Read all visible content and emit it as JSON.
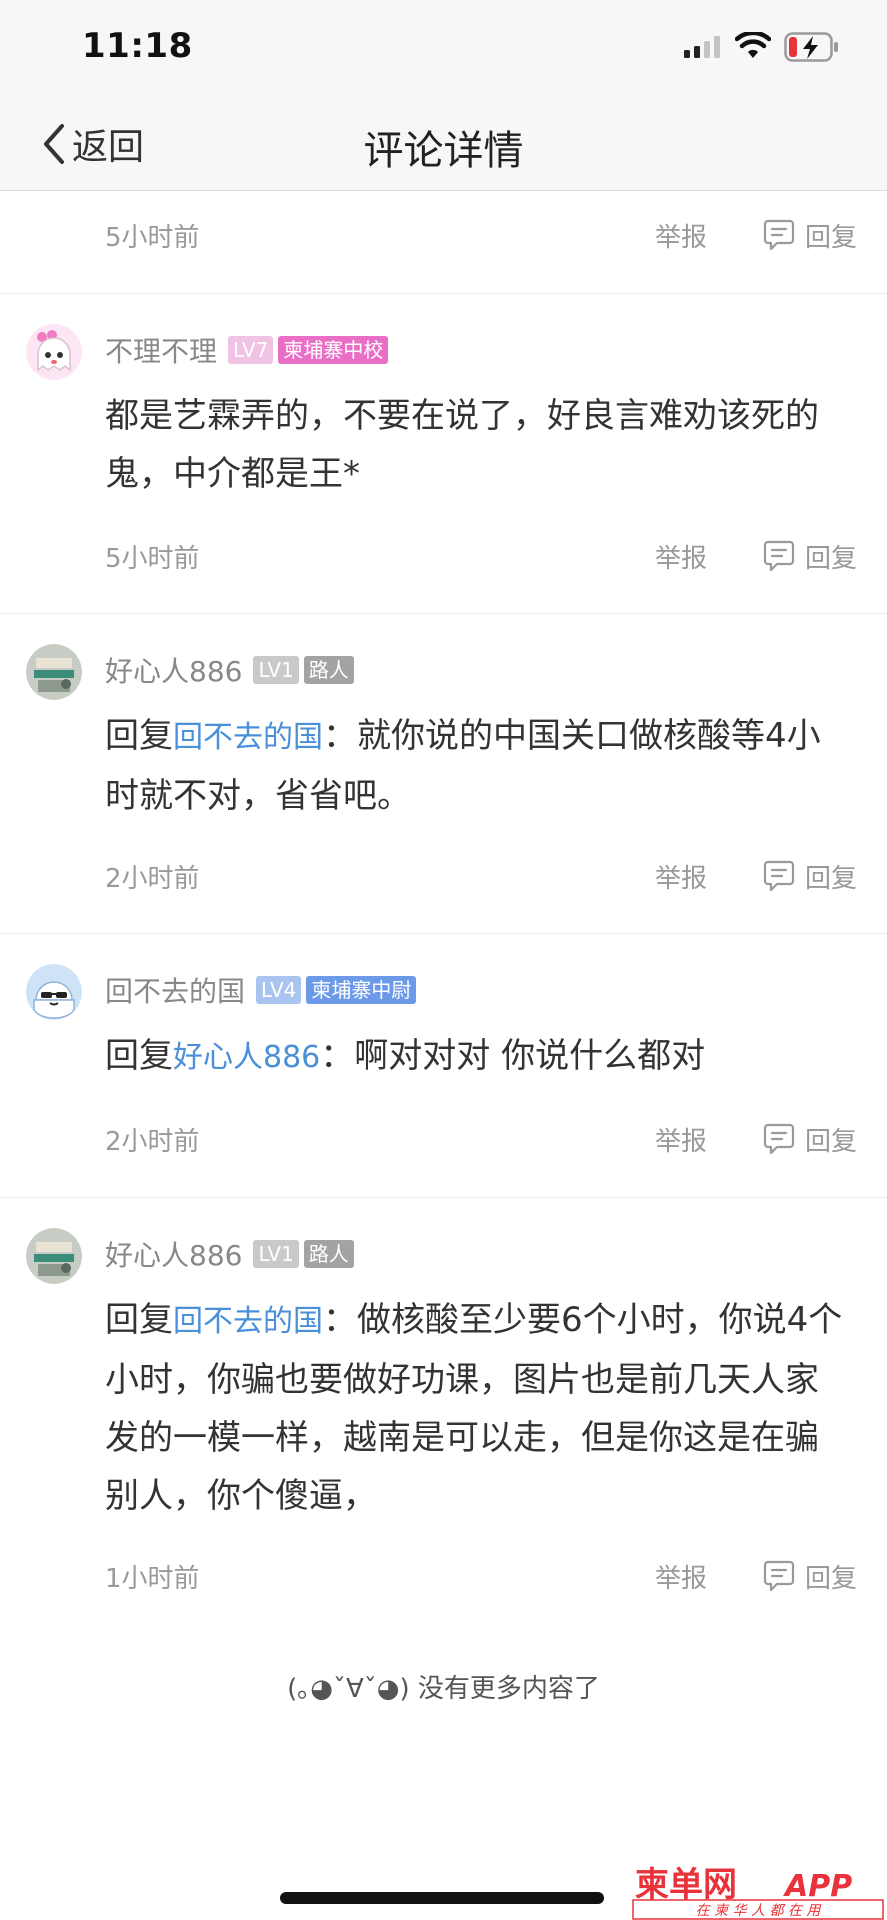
{
  "status_bar": {
    "time": "11:18",
    "icons": [
      "cellular-signal-icon",
      "wifi-icon",
      "battery-charging-icon"
    ],
    "battery_color": "#e8333b"
  },
  "nav": {
    "back_label": "返回",
    "title": "评论详情"
  },
  "colors": {
    "link": "#4a90d9",
    "badge_level_lv7": "#f0c2e3",
    "badge_title_pink": "#e96fc6",
    "badge_level_gray": "#c9c9c9",
    "badge_title_gray": "#a3a3a3",
    "badge_level_lv4": "#a9c4ee",
    "badge_title_blue": "#6d9ae8",
    "watermark_red": "#e8333b"
  },
  "actions": {
    "report_label": "举报",
    "reply_label": "回复",
    "reply_prefix": "回复",
    "colon": "："
  },
  "comments": [
    {
      "partial": true,
      "time": "5小时前"
    },
    {
      "username": "不理不理",
      "avatar": "cartoon-ghost-girl-avatar",
      "level": "LV7",
      "title": "柬埔寨中校",
      "text": "都是艺霖弄的，不要在说了，好良言难劝该死的鬼，中介都是王*",
      "time": "5小时前"
    },
    {
      "username": "好心人886",
      "avatar": "photo-avatar",
      "level": "LV1",
      "title": "路人",
      "reply_to": "回不去的国",
      "text": "就你说的中国关口做核酸等4小时就不对，省省吧。",
      "time": "2小时前"
    },
    {
      "username": "回不去的国",
      "avatar": "cartoon-sunglasses-avatar",
      "level": "LV4",
      "title": "柬埔寨中尉",
      "reply_to": "好心人886",
      "text": "啊对对对 你说什么都对",
      "time": "2小时前"
    },
    {
      "username": "好心人886",
      "avatar": "photo-avatar",
      "level": "LV1",
      "title": "路人",
      "reply_to": "回不去的国",
      "text": "做核酸至少要6个小时，你说4个小时，你骗也要做好功课，图片也是前几天人家发的一模一样，越南是可以走，但是你这是在骗别人，你个傻逼，",
      "time": "1小时前"
    }
  ],
  "end_message": "(｡◕ˇ∀ˇ◕) 没有更多内容了",
  "watermark": {
    "brand": "柬单网",
    "suffix": "APP",
    "slogan": "在 柬 华 人 都 在 用"
  }
}
